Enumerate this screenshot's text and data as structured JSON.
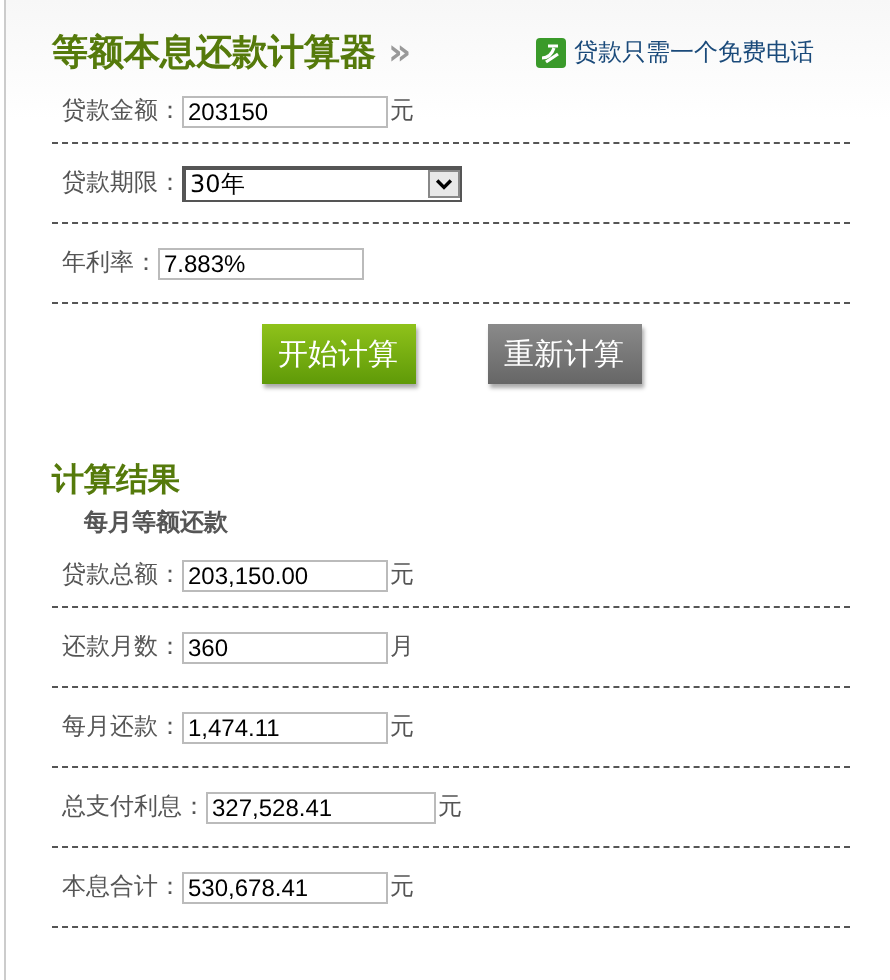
{
  "header": {
    "title": "等额本息还款计算器",
    "arrow": "»",
    "promo": "贷款只需一个免费电话"
  },
  "form": [
    {
      "kind": "input",
      "label": "贷款金额：",
      "value": "203150",
      "unit": "元"
    },
    {
      "kind": "select",
      "label": "贷款期限：",
      "value": "30年"
    },
    {
      "kind": "input",
      "label": "年利率：",
      "value": "7.883%"
    }
  ],
  "buttons": [
    {
      "kind": "primary",
      "label": "开始计算"
    },
    {
      "kind": "secondary",
      "label": "重新计算"
    }
  ],
  "results": {
    "title": "计算结果",
    "subtitle": "每月等额还款",
    "rows": [
      {
        "label": "贷款总额：",
        "value": "203,150.00",
        "unit": "元"
      },
      {
        "label": "还款月数：",
        "value": "360",
        "unit": "月"
      },
      {
        "label": "每月还款：",
        "value": "1,474.11",
        "unit": "元"
      },
      {
        "label": "总支付利息：",
        "value": "327,528.41",
        "unit": "元"
      },
      {
        "label": "本息合计：",
        "value": "530,678.41",
        "unit": "元"
      }
    ]
  }
}
